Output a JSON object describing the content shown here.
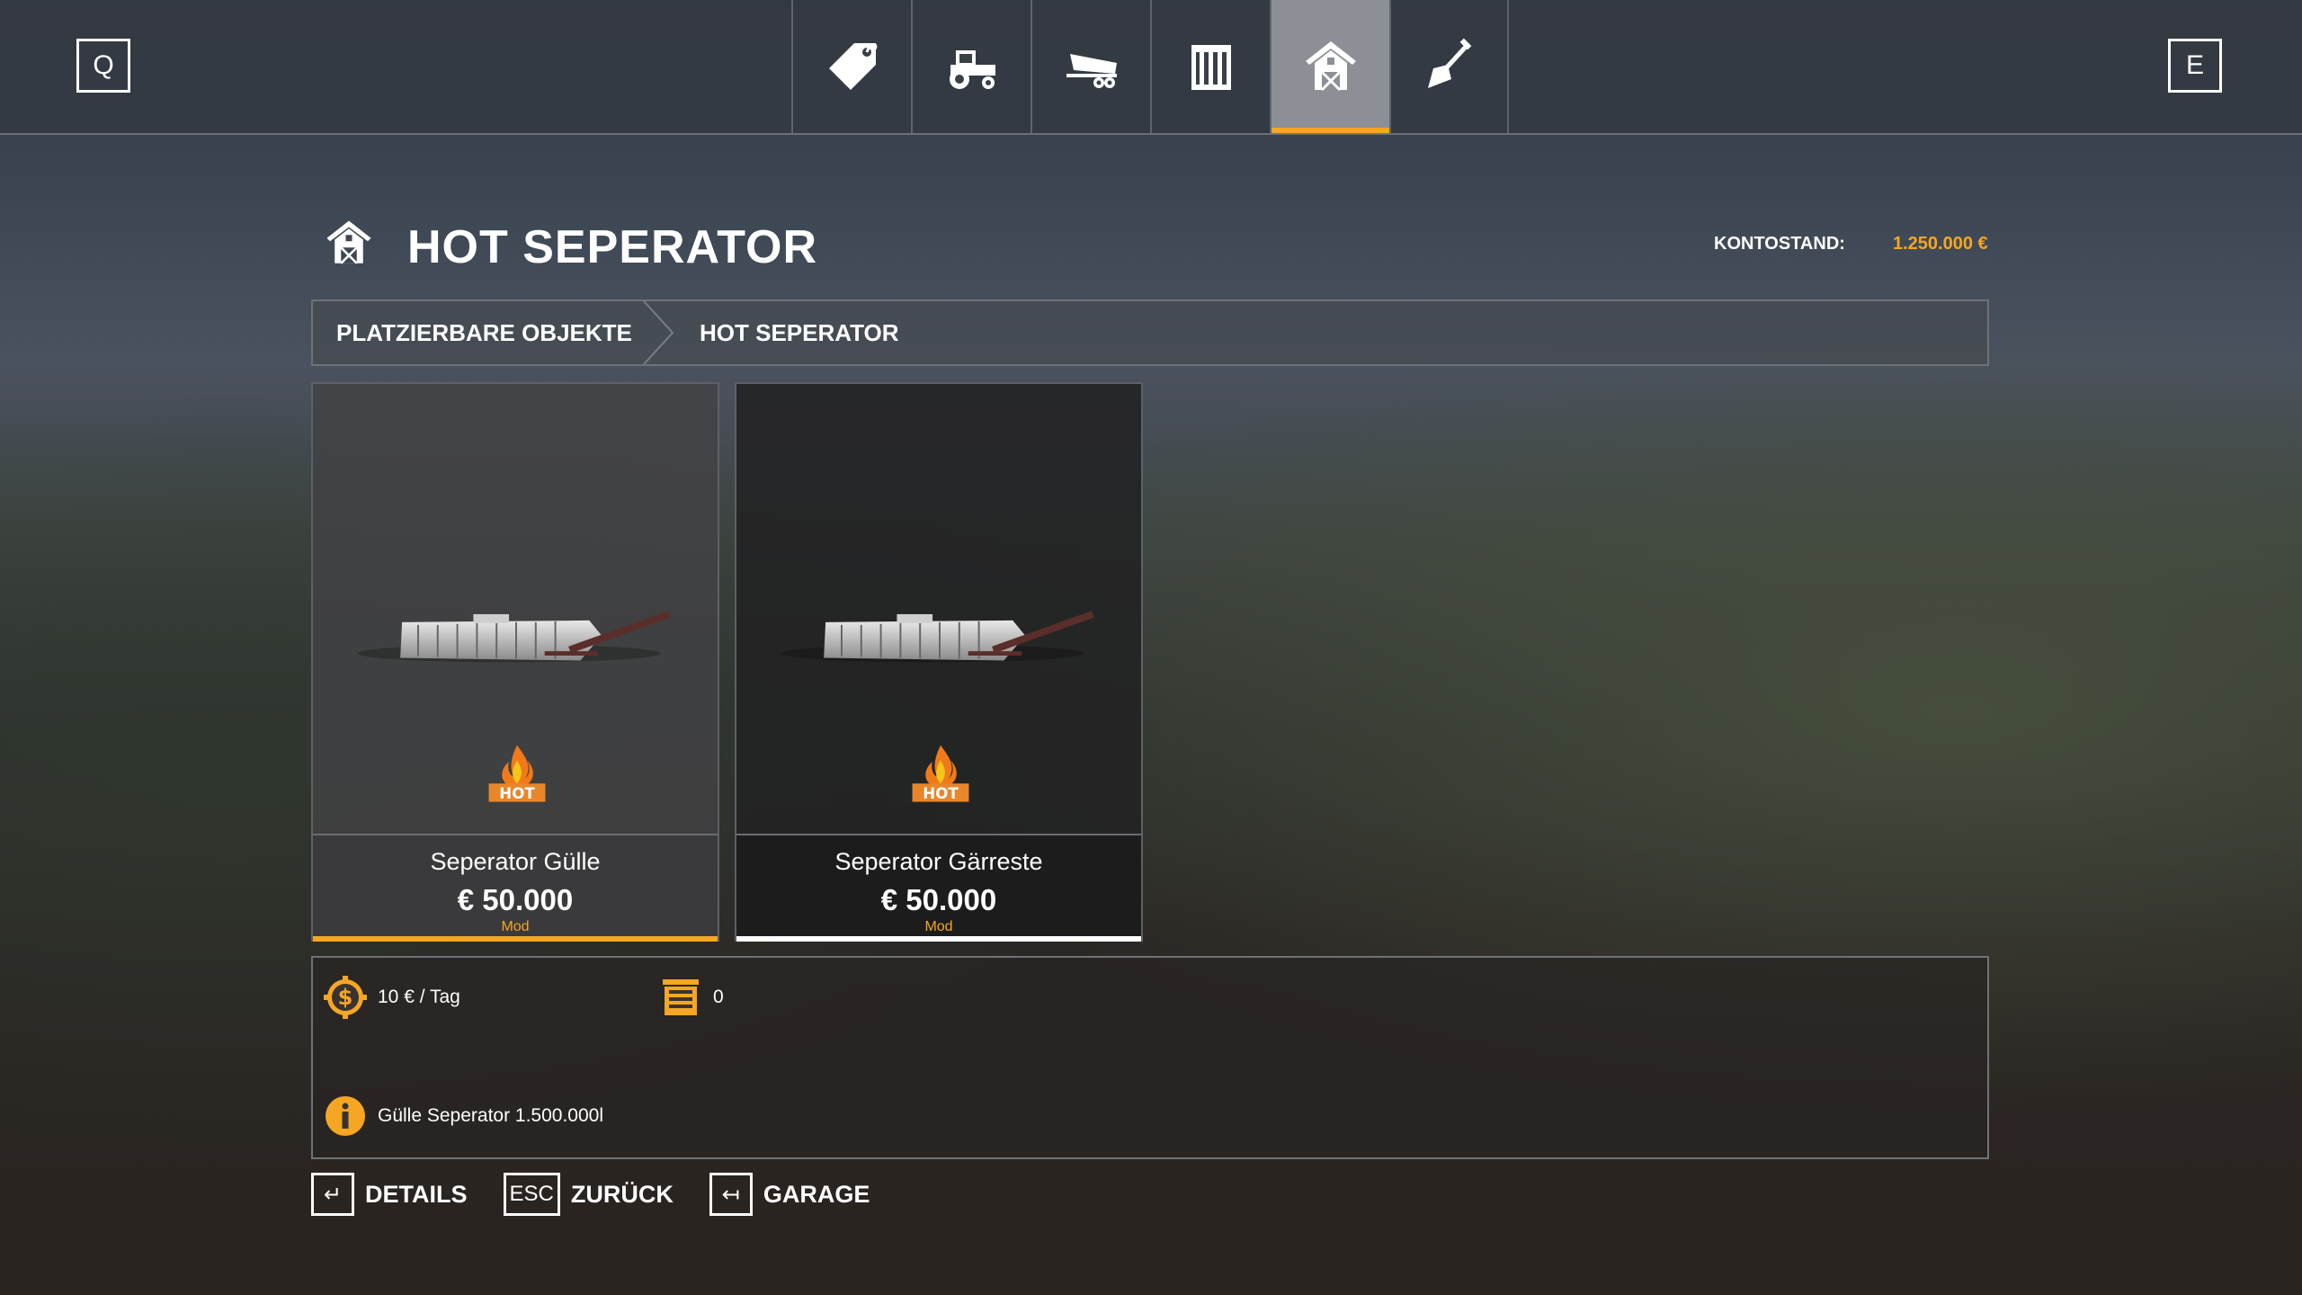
{
  "topbar": {
    "key_left": "Q",
    "key_right": "E",
    "tabs": [
      {
        "icon": "price-tag-icon",
        "active": false
      },
      {
        "icon": "tractor-icon",
        "active": false
      },
      {
        "icon": "trailer-icon",
        "active": false
      },
      {
        "icon": "crate-icon",
        "active": false
      },
      {
        "icon": "barn-icon",
        "active": true
      },
      {
        "icon": "shovel-icon",
        "active": false
      }
    ]
  },
  "header": {
    "title": "HOT SEPERATOR",
    "icon": "barn-icon",
    "balance_label": "KONTOSTAND:",
    "balance_value": "1.250.000 €"
  },
  "breadcrumb": {
    "items": [
      "PLATZIERBARE OBJEKTE",
      "HOT SEPERATOR"
    ]
  },
  "items": [
    {
      "name": "Seperator Gülle",
      "price": "€ 50.000",
      "tag": "Mod",
      "selected": true
    },
    {
      "name": "Seperator Gärreste",
      "price": "€ 50.000",
      "tag": "Mod",
      "selected": false
    }
  ],
  "details": {
    "daily_cost": "10 € / Tag",
    "owned_count": "0",
    "info": "Gülle Seperator 1.500.000l"
  },
  "footer": [
    {
      "key": "↵",
      "label": "DETAILS"
    },
    {
      "key": "ESC",
      "label": "ZURÜCK"
    },
    {
      "key": "↤",
      "label": "GARAGE"
    }
  ],
  "colors": {
    "accent": "#f5a623",
    "active_tab": "#8c9096"
  }
}
